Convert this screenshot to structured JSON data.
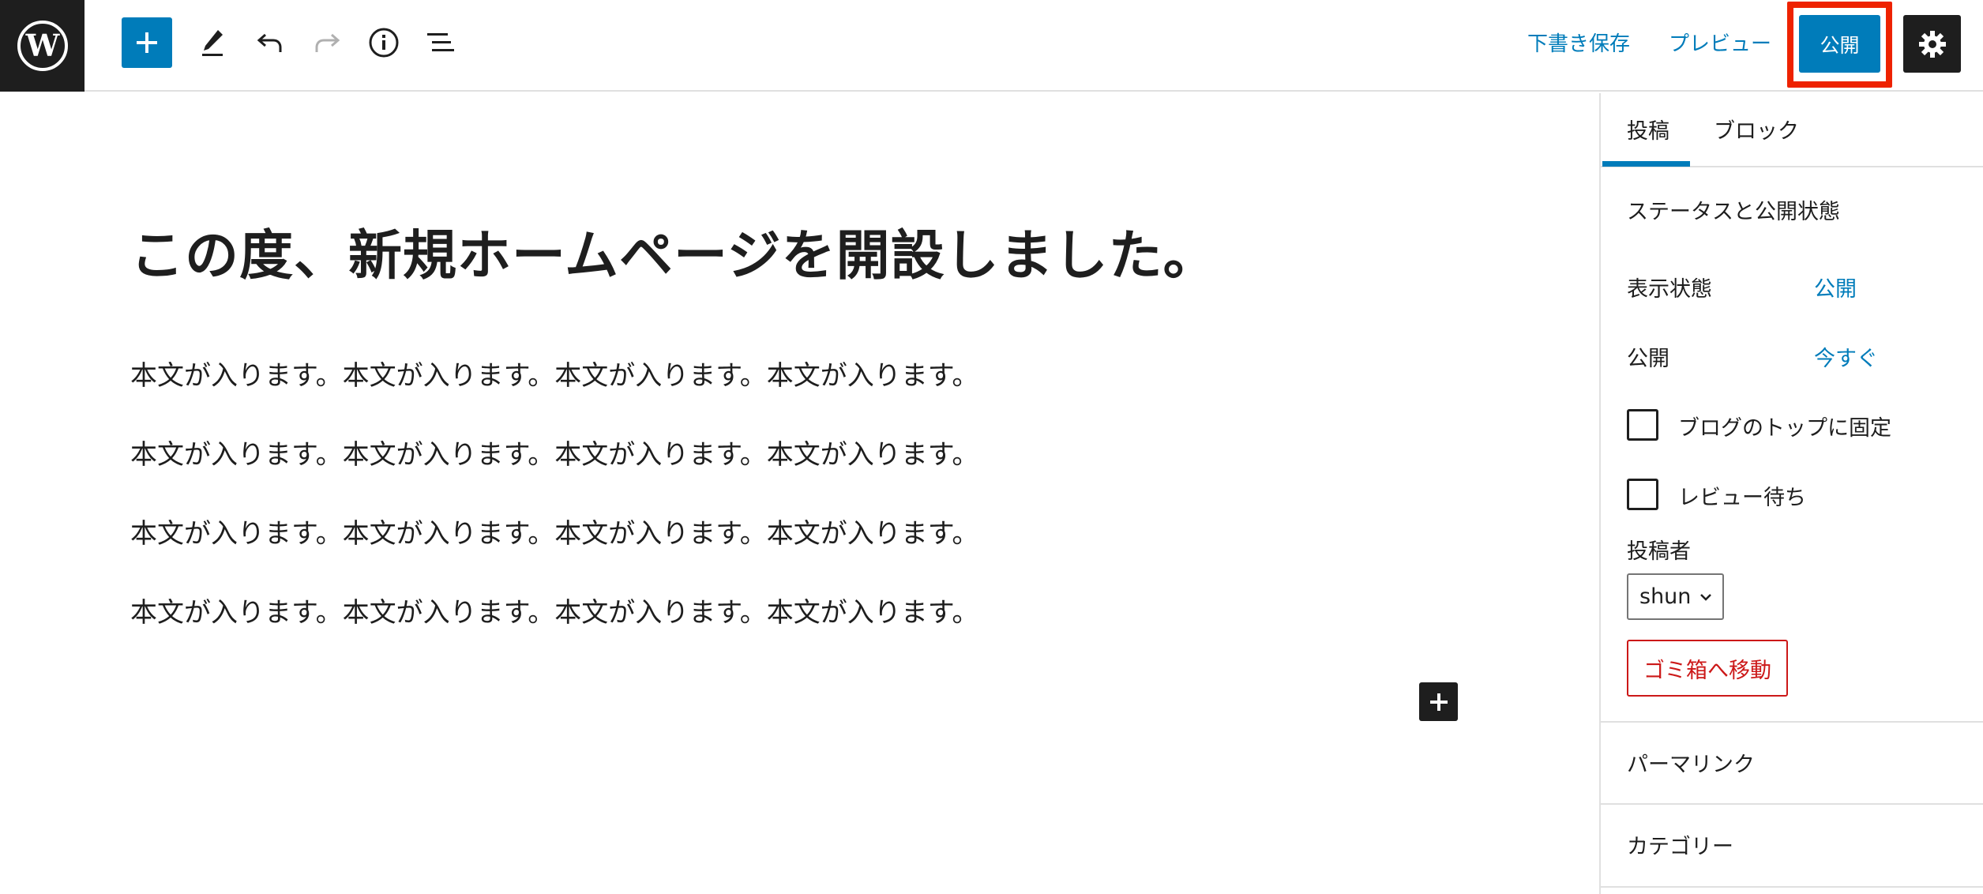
{
  "toolbar": {
    "logo_icon": "wordpress-logo-icon",
    "add_block_icon": "plus-icon",
    "tools_icon": "pencil-icon",
    "undo_icon": "undo-icon",
    "redo_icon": "redo-icon",
    "details_icon": "info-icon",
    "list_view_icon": "list-view-icon",
    "save_draft_label": "下書き保存",
    "preview_label": "プレビュー",
    "publish_label": "公開",
    "settings_icon": "gear-icon",
    "accent_color": "#007cba",
    "highlight_color": "#ee2200"
  },
  "editor": {
    "title": "この度、新規ホームページを開設しました。",
    "paragraphs": [
      "本文が入ります。本文が入ります。本文が入ります。本文が入ります。",
      "本文が入ります。本文が入ります。本文が入ります。本文が入ります。",
      "本文が入ります。本文が入ります。本文が入ります。本文が入ります。",
      "本文が入ります。本文が入ります。本文が入ります。本文が入ります。"
    ],
    "inserter_icon": "plus-icon"
  },
  "sidebar": {
    "tabs": [
      {
        "label": "投稿",
        "active": true
      },
      {
        "label": "ブロック",
        "active": false
      }
    ],
    "status_panel": {
      "title": "ステータスと公開状態",
      "visibility_label": "表示状態",
      "visibility_value": "公開",
      "publish_label": "公開",
      "publish_value": "今すぐ",
      "sticky_label": "ブログのトップに固定",
      "pending_label": "レビュー待ち",
      "author_label": "投稿者",
      "author_value": "shun",
      "trash_label": "ゴミ箱へ移動"
    },
    "permalink_title": "パーマリンク",
    "category_title": "カテゴリー"
  }
}
